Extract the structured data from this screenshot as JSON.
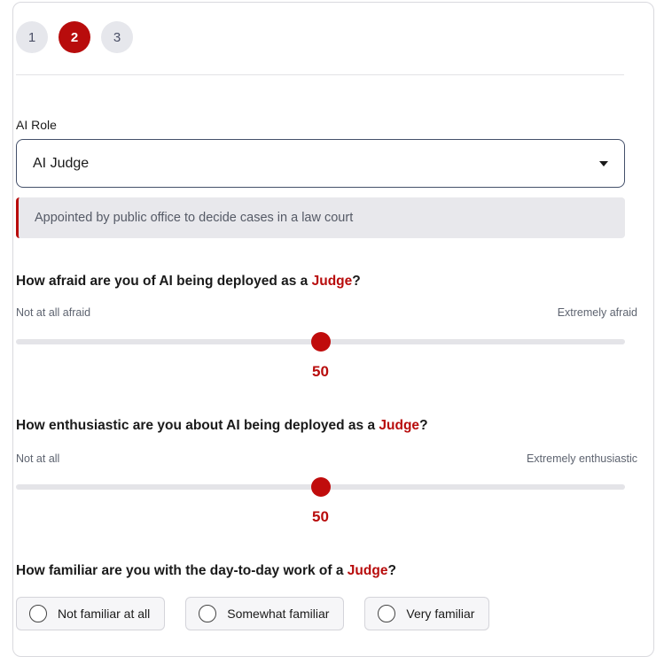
{
  "steps": [
    {
      "label": "1",
      "active": false
    },
    {
      "label": "2",
      "active": true
    },
    {
      "label": "3",
      "active": false
    }
  ],
  "role_field": {
    "label": "AI Role",
    "selected_value": "AI Judge",
    "description": "Appointed by public office to decide cases in a law court"
  },
  "role_name": "Judge",
  "questions": {
    "afraid": {
      "prefix": "How afraid are you of AI being deployed as a ",
      "suffix": "?",
      "min_label": "Not at all afraid",
      "max_label": "Extremely afraid",
      "value": 50,
      "value_text": "50",
      "range": [
        0,
        100
      ]
    },
    "enthusiastic": {
      "prefix": "How enthusiastic are you about AI being deployed as a ",
      "suffix": "?",
      "min_label": "Not at all",
      "max_label": "Extremely enthusiastic",
      "value": 50,
      "value_text": "50",
      "range": [
        0,
        100
      ]
    },
    "familiar": {
      "prefix": "How familiar are you with the day-to-day work of a ",
      "suffix": "?",
      "options": [
        "Not familiar at all",
        "Somewhat familiar",
        "Very familiar"
      ],
      "selected": null
    }
  },
  "colors": {
    "accent": "#b80c0c",
    "step_inactive_bg": "#e6e7ec",
    "description_bg": "#e8e8ec",
    "track": "#e4e4e8"
  },
  "icons": {
    "select_caret": "chevron-down-icon",
    "radio": "radio-unchecked-icon"
  }
}
